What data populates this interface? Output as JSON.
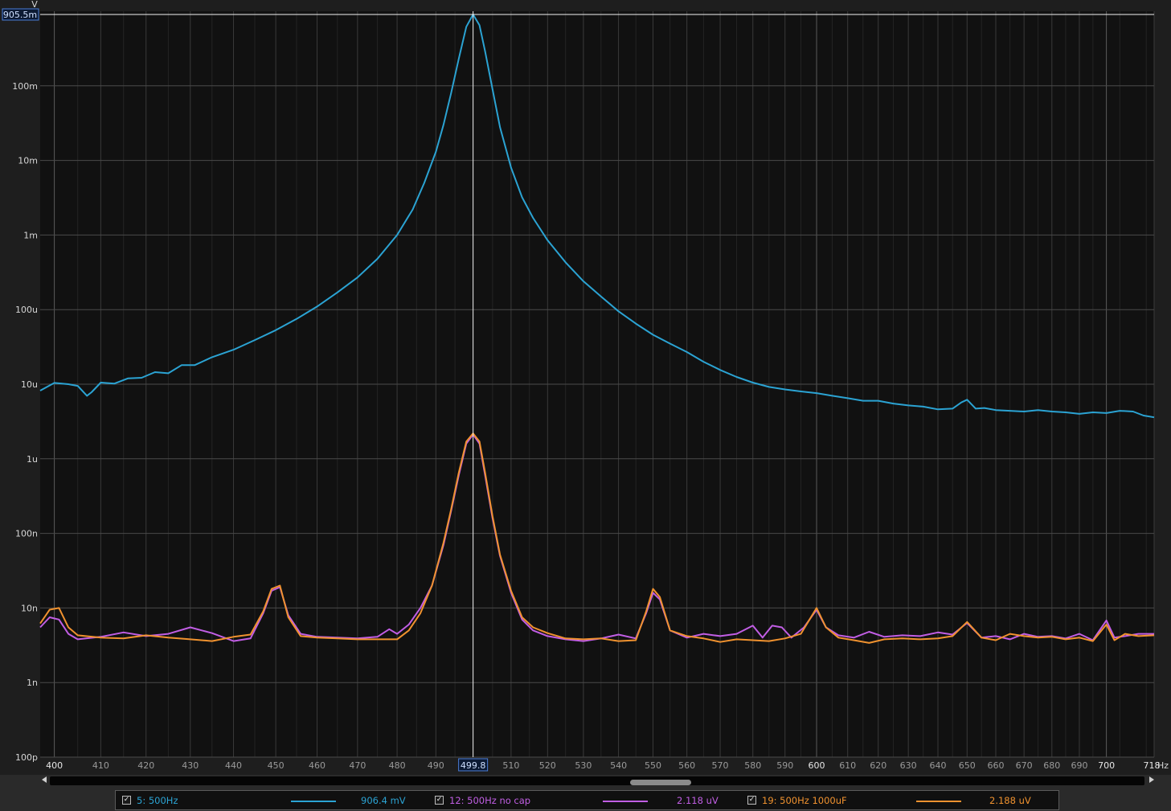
{
  "chart_data": {
    "type": "line",
    "xlabel": "Hz",
    "ylabel": "V",
    "x_scale": "log",
    "y_scale": "log",
    "xlim": [
      397,
      718
    ],
    "ylim": [
      1e-10,
      1.0
    ],
    "y_ticks": [
      "905.5m",
      "100m",
      "10m",
      "1m",
      "100u",
      "10u",
      "1u",
      "100n",
      "10n",
      "1n",
      "100p"
    ],
    "x_ticks": [
      "400",
      "410",
      "420",
      "430",
      "440",
      "450",
      "460",
      "470",
      "480",
      "490",
      "499.8",
      "510",
      "520",
      "530",
      "540",
      "550",
      "560",
      "570",
      "580",
      "590",
      "600",
      "610",
      "620",
      "630",
      "640",
      "650",
      "660",
      "670",
      "680",
      "690",
      "700",
      "718"
    ],
    "x_major_ticks": [
      "400",
      "500",
      "600",
      "700"
    ],
    "cursor": {
      "x": 499.8,
      "x_label": "499.8",
      "y_label": "905.5m"
    },
    "grid": true,
    "background": "#111111",
    "series": [
      {
        "name": "5: 500Hz",
        "color": "#2ba3d3",
        "readout": "906.4 mV",
        "points": [
          [
            397,
            8.2e-06
          ],
          [
            400,
            1.04e-05
          ],
          [
            403,
            1e-05
          ],
          [
            405,
            9.5e-06
          ],
          [
            407,
            7e-06
          ],
          [
            408,
            7.8e-06
          ],
          [
            410,
            1.05e-05
          ],
          [
            413,
            1.02e-05
          ],
          [
            416,
            1.2e-05
          ],
          [
            419,
            1.22e-05
          ],
          [
            422,
            1.45e-05
          ],
          [
            425,
            1.4e-05
          ],
          [
            428,
            1.8e-05
          ],
          [
            431,
            1.8e-05
          ],
          [
            435,
            2.3e-05
          ],
          [
            440,
            2.9e-05
          ],
          [
            445,
            3.9e-05
          ],
          [
            450,
            5.3e-05
          ],
          [
            455,
            7.5e-05
          ],
          [
            460,
            0.00011
          ],
          [
            465,
            0.00017
          ],
          [
            470,
            0.00027
          ],
          [
            475,
            0.00048
          ],
          [
            480,
            0.001
          ],
          [
            484,
            0.0022
          ],
          [
            487,
            0.005
          ],
          [
            490,
            0.013
          ],
          [
            492,
            0.03
          ],
          [
            494,
            0.08
          ],
          [
            496,
            0.23
          ],
          [
            498,
            0.62
          ],
          [
            499.8,
            0.906
          ],
          [
            501.5,
            0.65
          ],
          [
            503,
            0.29
          ],
          [
            505,
            0.09
          ],
          [
            507,
            0.028
          ],
          [
            510,
            0.008
          ],
          [
            513,
            0.0032
          ],
          [
            516,
            0.0017
          ],
          [
            520,
            0.00085
          ],
          [
            525,
            0.00043
          ],
          [
            530,
            0.00024
          ],
          [
            535,
            0.00015
          ],
          [
            540,
            9.5e-05
          ],
          [
            545,
            6.5e-05
          ],
          [
            550,
            4.6e-05
          ],
          [
            555,
            3.5e-05
          ],
          [
            560,
            2.7e-05
          ],
          [
            565,
            2e-05
          ],
          [
            570,
            1.55e-05
          ],
          [
            575,
            1.25e-05
          ],
          [
            580,
            1.05e-05
          ],
          [
            585,
            9.2e-06
          ],
          [
            590,
            8.5e-06
          ],
          [
            595,
            8e-06
          ],
          [
            600,
            7.6e-06
          ],
          [
            605,
            7e-06
          ],
          [
            610,
            6.5e-06
          ],
          [
            615,
            6e-06
          ],
          [
            620,
            6e-06
          ],
          [
            625,
            5.5e-06
          ],
          [
            630,
            5.2e-06
          ],
          [
            635,
            5e-06
          ],
          [
            640,
            4.6e-06
          ],
          [
            645,
            4.7e-06
          ],
          [
            648,
            5.7e-06
          ],
          [
            650,
            6.2e-06
          ],
          [
            653,
            4.7e-06
          ],
          [
            656,
            4.8e-06
          ],
          [
            660,
            4.5e-06
          ],
          [
            665,
            4.4e-06
          ],
          [
            670,
            4.3e-06
          ],
          [
            675,
            4.5e-06
          ],
          [
            680,
            4.3e-06
          ],
          [
            685,
            4.2e-06
          ],
          [
            690,
            4e-06
          ],
          [
            695,
            4.2e-06
          ],
          [
            700,
            4.1e-06
          ],
          [
            705,
            4.4e-06
          ],
          [
            710,
            4.3e-06
          ],
          [
            714,
            3.8e-06
          ],
          [
            718,
            3.6e-06
          ]
        ]
      },
      {
        "name": "12: 500Hz no cap",
        "color": "#c15ee4",
        "readout": "2.118 uV",
        "points": [
          [
            397,
            5.5e-09
          ],
          [
            399,
            7.5e-09
          ],
          [
            401,
            7e-09
          ],
          [
            403,
            4.5e-09
          ],
          [
            405,
            3.8e-09
          ],
          [
            410,
            4.1e-09
          ],
          [
            415,
            4.7e-09
          ],
          [
            420,
            4.2e-09
          ],
          [
            425,
            4.5e-09
          ],
          [
            430,
            5.5e-09
          ],
          [
            435,
            4.6e-09
          ],
          [
            440,
            3.6e-09
          ],
          [
            444,
            3.9e-09
          ],
          [
            447,
            8.5e-09
          ],
          [
            449,
            1.7e-08
          ],
          [
            451,
            1.9e-08
          ],
          [
            453,
            8e-09
          ],
          [
            456,
            4.5e-09
          ],
          [
            460,
            4.1e-09
          ],
          [
            465,
            4e-09
          ],
          [
            470,
            3.9e-09
          ],
          [
            475,
            4.1e-09
          ],
          [
            478,
            5.2e-09
          ],
          [
            480,
            4.5e-09
          ],
          [
            483,
            6e-09
          ],
          [
            486,
            1e-08
          ],
          [
            489,
            2e-08
          ],
          [
            492,
            7e-08
          ],
          [
            494,
            2e-07
          ],
          [
            496,
            6e-07
          ],
          [
            498,
            1.6e-06
          ],
          [
            499.8,
            2.118e-06
          ],
          [
            501.5,
            1.6e-06
          ],
          [
            503,
            6e-07
          ],
          [
            505,
            1.6e-07
          ],
          [
            507,
            5e-08
          ],
          [
            510,
            1.6e-08
          ],
          [
            513,
            7e-09
          ],
          [
            516,
            5e-09
          ],
          [
            520,
            4.2e-09
          ],
          [
            525,
            3.8e-09
          ],
          [
            530,
            3.6e-09
          ],
          [
            535,
            3.9e-09
          ],
          [
            540,
            4.4e-09
          ],
          [
            545,
            3.9e-09
          ],
          [
            548,
            8.5e-09
          ],
          [
            550,
            1.6e-08
          ],
          [
            552,
            1.3e-08
          ],
          [
            555,
            5e-09
          ],
          [
            560,
            4e-09
          ],
          [
            565,
            4.5e-09
          ],
          [
            570,
            4.2e-09
          ],
          [
            575,
            4.5e-09
          ],
          [
            580,
            5.8e-09
          ],
          [
            583,
            4e-09
          ],
          [
            586,
            5.8e-09
          ],
          [
            589,
            5.5e-09
          ],
          [
            592,
            4e-09
          ],
          [
            596,
            5.5e-09
          ],
          [
            600,
            9.5e-09
          ],
          [
            603,
            5.5e-09
          ],
          [
            607,
            4.3e-09
          ],
          [
            612,
            4e-09
          ],
          [
            617,
            4.8e-09
          ],
          [
            622,
            4.1e-09
          ],
          [
            628,
            4.3e-09
          ],
          [
            634,
            4.2e-09
          ],
          [
            640,
            4.7e-09
          ],
          [
            645,
            4.4e-09
          ],
          [
            650,
            6.3e-09
          ],
          [
            655,
            4e-09
          ],
          [
            660,
            4.2e-09
          ],
          [
            665,
            3.8e-09
          ],
          [
            670,
            4.5e-09
          ],
          [
            675,
            4.1e-09
          ],
          [
            680,
            4.2e-09
          ],
          [
            685,
            3.9e-09
          ],
          [
            690,
            4.5e-09
          ],
          [
            695,
            3.7e-09
          ],
          [
            700,
            6.8e-09
          ],
          [
            703,
            4e-09
          ],
          [
            707,
            4.2e-09
          ],
          [
            712,
            4.5e-09
          ],
          [
            718,
            4.5e-09
          ]
        ]
      },
      {
        "name": "19: 500Hz 1000uF",
        "color": "#f0922f",
        "readout": "2.188 uV",
        "points": [
          [
            397,
            6.2e-09
          ],
          [
            399,
            9.5e-09
          ],
          [
            401,
            1e-08
          ],
          [
            403,
            5.5e-09
          ],
          [
            405,
            4.3e-09
          ],
          [
            410,
            4e-09
          ],
          [
            415,
            3.9e-09
          ],
          [
            420,
            4.3e-09
          ],
          [
            425,
            4e-09
          ],
          [
            430,
            3.8e-09
          ],
          [
            435,
            3.6e-09
          ],
          [
            440,
            4.1e-09
          ],
          [
            444,
            4.4e-09
          ],
          [
            447,
            9e-09
          ],
          [
            449,
            1.8e-08
          ],
          [
            451,
            2e-08
          ],
          [
            453,
            7.5e-09
          ],
          [
            456,
            4.2e-09
          ],
          [
            460,
            4e-09
          ],
          [
            465,
            3.9e-09
          ],
          [
            470,
            3.8e-09
          ],
          [
            475,
            3.8e-09
          ],
          [
            480,
            3.8e-09
          ],
          [
            483,
            5e-09
          ],
          [
            486,
            8.5e-09
          ],
          [
            489,
            2e-08
          ],
          [
            492,
            7.5e-08
          ],
          [
            494,
            2.1e-07
          ],
          [
            496,
            6.5e-07
          ],
          [
            498,
            1.7e-06
          ],
          [
            499.8,
            2.188e-06
          ],
          [
            501.5,
            1.7e-06
          ],
          [
            503,
            6.5e-07
          ],
          [
            505,
            1.7e-07
          ],
          [
            507,
            5.2e-08
          ],
          [
            510,
            1.7e-08
          ],
          [
            513,
            7.5e-09
          ],
          [
            516,
            5.5e-09
          ],
          [
            520,
            4.6e-09
          ],
          [
            525,
            3.9e-09
          ],
          [
            530,
            3.8e-09
          ],
          [
            535,
            3.9e-09
          ],
          [
            540,
            3.6e-09
          ],
          [
            545,
            3.7e-09
          ],
          [
            548,
            9e-09
          ],
          [
            550,
            1.8e-08
          ],
          [
            552,
            1.4e-08
          ],
          [
            555,
            5e-09
          ],
          [
            560,
            4.2e-09
          ],
          [
            565,
            3.9e-09
          ],
          [
            570,
            3.5e-09
          ],
          [
            575,
            3.8e-09
          ],
          [
            580,
            3.7e-09
          ],
          [
            585,
            3.6e-09
          ],
          [
            590,
            3.9e-09
          ],
          [
            595,
            4.5e-09
          ],
          [
            600,
            1e-08
          ],
          [
            603,
            5.5e-09
          ],
          [
            607,
            4e-09
          ],
          [
            612,
            3.7e-09
          ],
          [
            617,
            3.4e-09
          ],
          [
            622,
            3.8e-09
          ],
          [
            628,
            3.9e-09
          ],
          [
            634,
            3.8e-09
          ],
          [
            640,
            3.9e-09
          ],
          [
            645,
            4.2e-09
          ],
          [
            650,
            6.5e-09
          ],
          [
            655,
            4e-09
          ],
          [
            660,
            3.7e-09
          ],
          [
            665,
            4.5e-09
          ],
          [
            670,
            4.2e-09
          ],
          [
            675,
            4e-09
          ],
          [
            680,
            4.1e-09
          ],
          [
            685,
            3.8e-09
          ],
          [
            690,
            4e-09
          ],
          [
            695,
            3.6e-09
          ],
          [
            700,
            6e-09
          ],
          [
            703,
            3.7e-09
          ],
          [
            707,
            4.5e-09
          ],
          [
            712,
            4.2e-09
          ],
          [
            718,
            4.3e-09
          ]
        ]
      }
    ]
  },
  "legend": [
    {
      "checked": "✓",
      "label": "5: 500Hz",
      "value": "906.4 mV",
      "color": "#2ba3d3"
    },
    {
      "checked": "✓",
      "label": "12: 500Hz no cap",
      "value": "2.118 uV",
      "color": "#c15ee4"
    },
    {
      "checked": "✓",
      "label": "19: 500Hz 1000uF",
      "value": "2.188 uV",
      "color": "#f0922f"
    }
  ]
}
